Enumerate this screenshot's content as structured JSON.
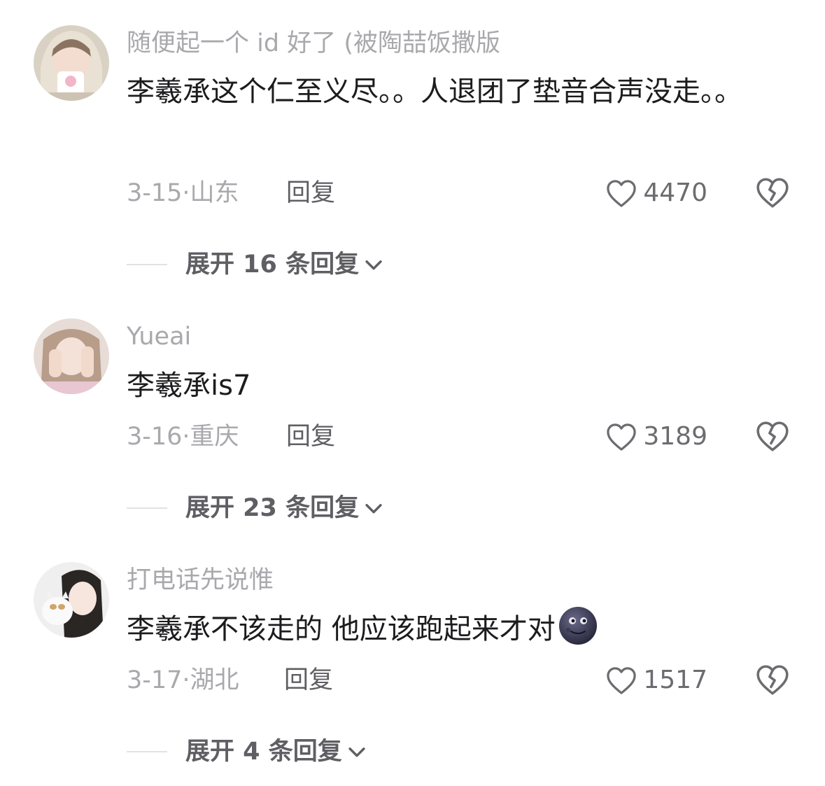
{
  "comments": [
    {
      "username": "随便起一个 id 好了 (被陶喆饭撒版",
      "content": "李羲承这个仁至义尽。。人退团了垫音合声没走。。",
      "date_location": "3-15·山东",
      "reply_label": "回复",
      "likes": "4470",
      "expand_label": "展开 16 条回复"
    },
    {
      "username": "Yueai",
      "content": "李羲承is7",
      "date_location": "3-16·重庆",
      "reply_label": "回复",
      "likes": "3189",
      "expand_label": "展开 23 条回复"
    },
    {
      "username": "打电话先说惟",
      "content": "李羲承不该走的 他应该跑起来才对",
      "emoji": "new-moon-face-emoji",
      "date_location": "3-17·湖北",
      "reply_label": "回复",
      "likes": "1517",
      "expand_label": "展开 4 条回复"
    }
  ],
  "icons": {
    "like": "heart-outline-icon",
    "dislike": "broken-heart-outline-icon",
    "expand": "chevron-down-icon"
  },
  "colors": {
    "username": "#a9a9ad",
    "content": "#1c1c1e",
    "meta": "#a9a9ad",
    "reply": "#5e5e63",
    "icon": "#6c6c70"
  }
}
